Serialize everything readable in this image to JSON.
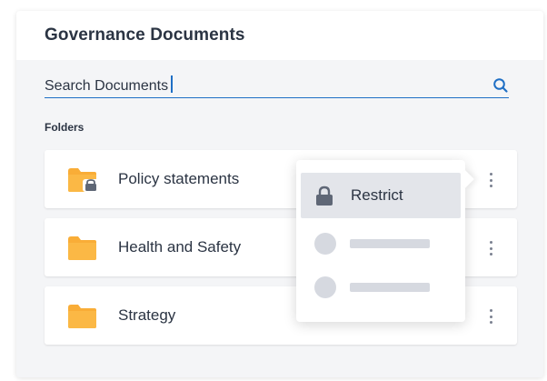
{
  "header": {
    "title": "Governance Documents"
  },
  "search": {
    "value": "Search Documents"
  },
  "folders_section": {
    "label": "Folders",
    "items": [
      {
        "label": "Policy statements",
        "icon": "locked-folder-icon",
        "restricted": true
      },
      {
        "label": "Health and Safety",
        "icon": "folder-icon",
        "restricted": false
      },
      {
        "label": "Strategy",
        "icon": "folder-icon",
        "restricted": false
      }
    ]
  },
  "context_menu": {
    "items": [
      {
        "label": "Restrict",
        "icon": "lock-icon",
        "active": true
      }
    ],
    "placeholder_items": 2
  },
  "colors": {
    "accent": "#1f6fc5",
    "folder": "#f9ad37",
    "text": "#2b3443",
    "background": "#f4f5f7"
  }
}
